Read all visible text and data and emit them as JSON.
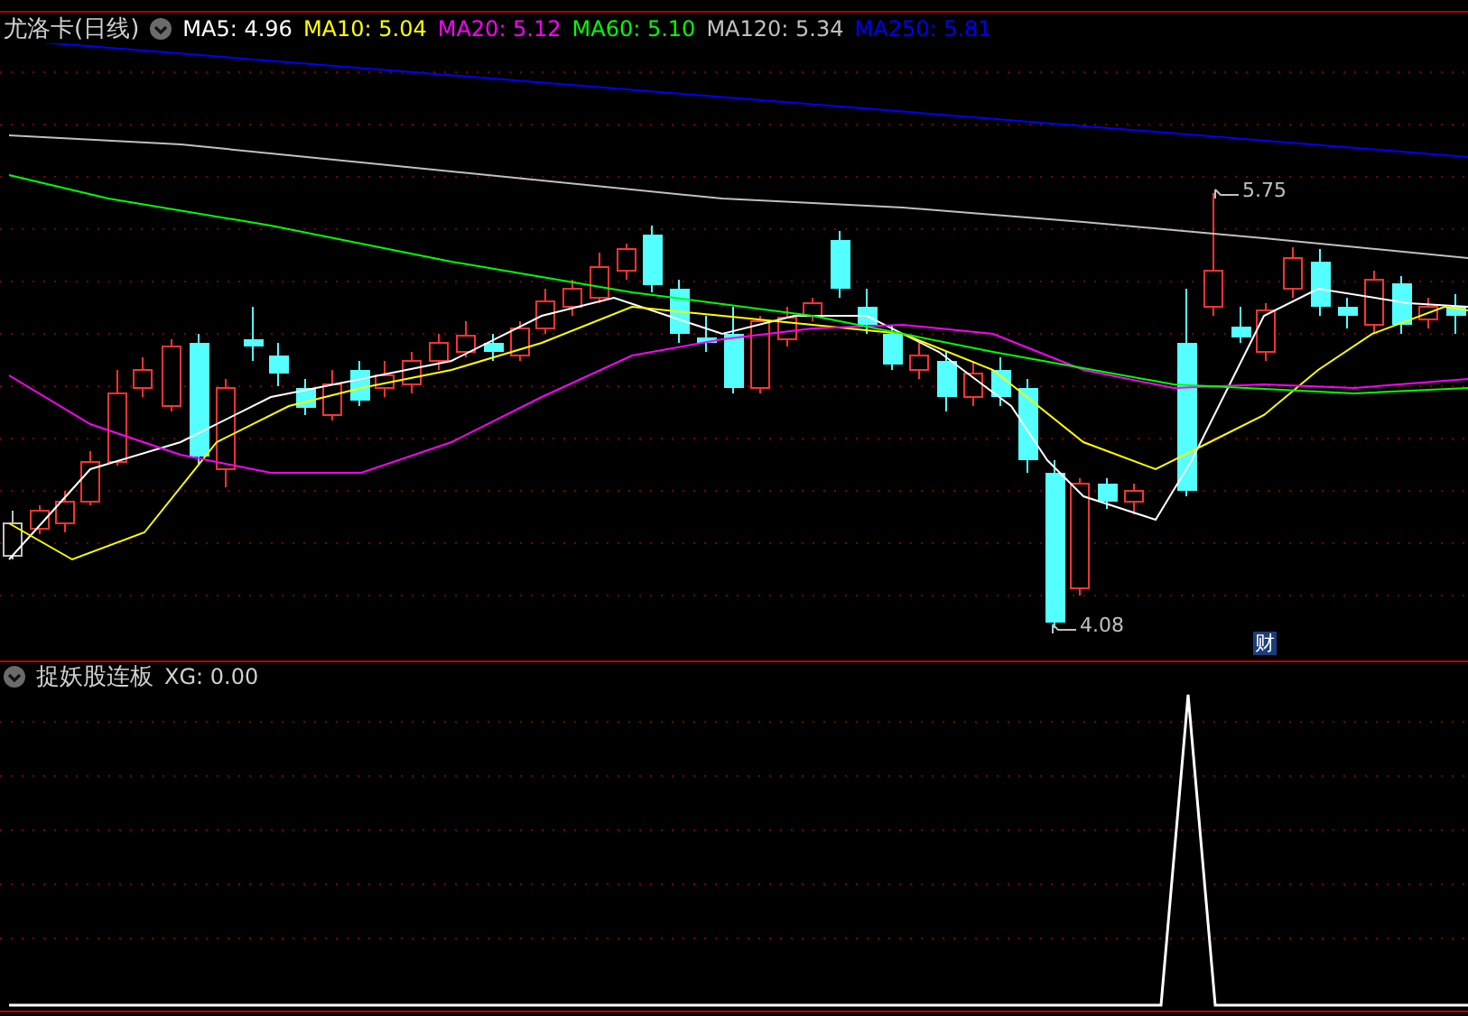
{
  "main_panel": {
    "title": "尤洛卡(日线)",
    "indicators": [
      {
        "text": "MA5: 4.96",
        "color": "#ffffff"
      },
      {
        "text": "MA10: 5.04",
        "color": "#ffff00"
      },
      {
        "text": "MA20: 5.12",
        "color": "#ff00ff"
      },
      {
        "text": "MA60: 5.10",
        "color": "#00ff00"
      },
      {
        "text": "MA120: 5.34",
        "color": "#c0c0c0"
      },
      {
        "text": "MA250: 5.81",
        "color": "#0000ff"
      }
    ],
    "high_label": "5.75",
    "low_label": "4.08",
    "badge": "财"
  },
  "sub_panel": {
    "title": "捉妖股连板",
    "reading": "XG: 0.00"
  }
}
